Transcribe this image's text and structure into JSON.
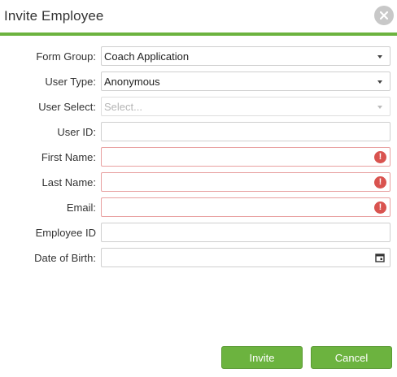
{
  "dialog": {
    "title": "Invite Employee"
  },
  "form": {
    "form_group": {
      "label": "Form Group:",
      "value": "Coach Application"
    },
    "user_type": {
      "label": "User Type:",
      "value": "Anonymous"
    },
    "user_select": {
      "label": "User Select:",
      "placeholder": "Select..."
    },
    "user_id": {
      "label": "User ID:",
      "value": ""
    },
    "first_name": {
      "label": "First Name:",
      "value": ""
    },
    "last_name": {
      "label": "Last Name:",
      "value": ""
    },
    "email": {
      "label": "Email:",
      "value": ""
    },
    "employee_id": {
      "label": "Employee ID",
      "value": ""
    },
    "date_of_birth": {
      "label": "Date of Birth:",
      "value": ""
    }
  },
  "buttons": {
    "invite": "Invite",
    "cancel": "Cancel"
  },
  "colors": {
    "accent": "#6cb33f",
    "error": "#d9534f"
  }
}
